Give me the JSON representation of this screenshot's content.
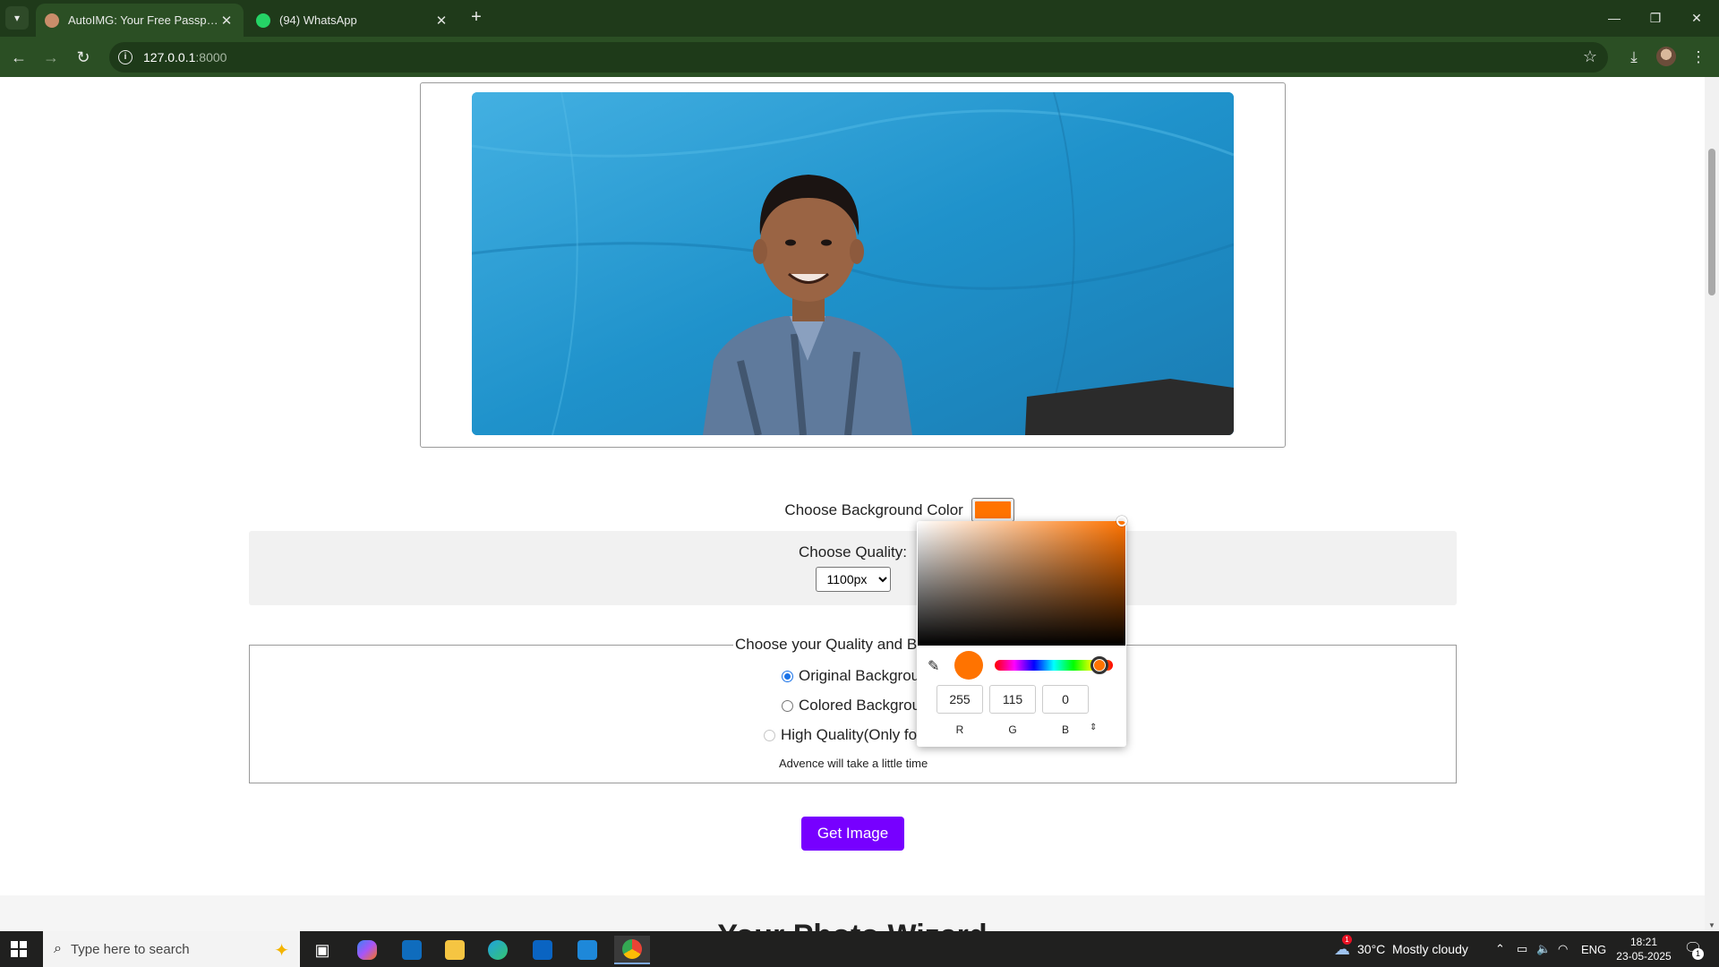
{
  "browser": {
    "tabs": [
      {
        "title": "AutoIMG: Your Free Passport to",
        "active": true,
        "favicon_color": "#c98d6a"
      },
      {
        "title": "(94) WhatsApp",
        "active": false,
        "favicon_color": "#25d366"
      }
    ],
    "address": {
      "host": "127.0.0.1",
      "port": ":8000"
    }
  },
  "page": {
    "bg_color_label": "Choose Background Color",
    "selected_color": "#ff7300",
    "quality_label": "Choose Quality:",
    "quality_value": "1100px",
    "mode_legend": "Choose your Quality and Bac",
    "options": [
      {
        "label": "Original Backgroun",
        "checked": true
      },
      {
        "label": "Colored Backgroun",
        "checked": false
      },
      {
        "label": "High Quality(Only for",
        "checked": false,
        "disabled": true
      }
    ],
    "note": "Advence will take a little time",
    "get_button": "Get Image",
    "lower_heading": "Your Photo Wizard"
  },
  "color_picker": {
    "r": "255",
    "g": "115",
    "b": "0",
    "r_label": "R",
    "g_label": "G",
    "b_label": "B"
  },
  "taskbar": {
    "search_placeholder": "Type here to search",
    "weather": "30°C  Mostly cloudy",
    "weather_badge": "1",
    "language": "ENG",
    "time": "18:21",
    "date": "23-05-2025",
    "notification_count": "1"
  },
  "colors": {
    "accent": "#7700ff",
    "chrome": "#2b4f24",
    "photo_bg": "#1e8fc8"
  }
}
